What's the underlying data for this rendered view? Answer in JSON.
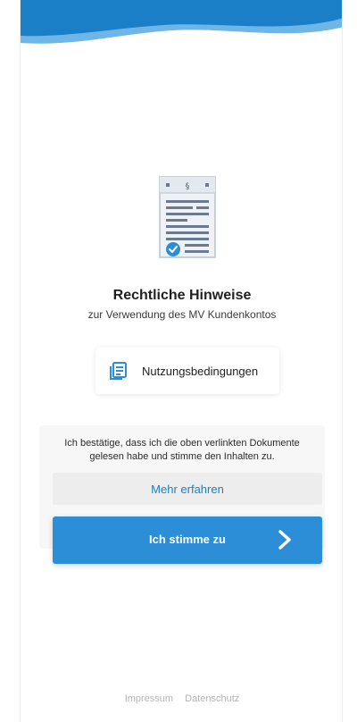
{
  "header": {
    "wave_color": "#1a7fc6",
    "wave_color_light": "#6fb5e6"
  },
  "illustration": {
    "icon": "legal-document-check-icon",
    "section_symbol": "§"
  },
  "content": {
    "title": "Rechtliche Hinweise",
    "subtitle": "zur Verwendung des MV Kundenkontos"
  },
  "documents": [
    {
      "icon": "document-list-icon",
      "label": "Nutzungsbedingungen"
    }
  ],
  "confirm": {
    "text": "Ich bestätige, dass ich die oben verlinkten Dokumente gelesen habe und stimme den Inhalten zu.",
    "more_label": "Mehr erfahren",
    "agree_label": "Ich stimme zu",
    "agree_icon": "chevron-right-icon",
    "accent": "#2b8ed6"
  },
  "footer": {
    "links": [
      "Impressum",
      "Datenschutz"
    ]
  }
}
